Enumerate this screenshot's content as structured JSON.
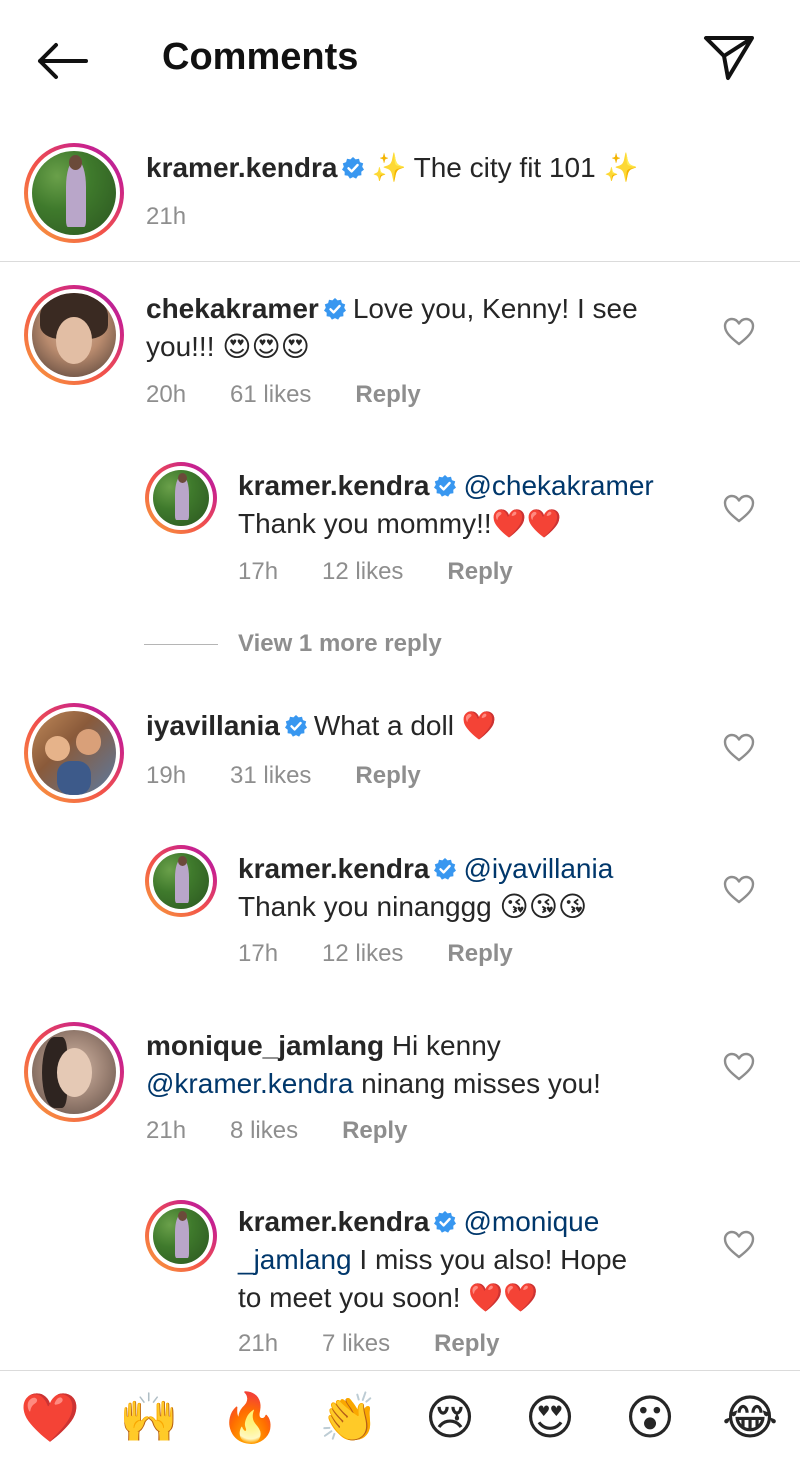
{
  "header": {
    "title": "Comments",
    "back_icon": "arrow-left-icon",
    "share_icon": "paper-plane-icon"
  },
  "caption": {
    "username": "kramer.kendra",
    "verified": true,
    "text": "✨ The city fit 101 ✨",
    "time": "21h"
  },
  "comments": [
    {
      "username": "chekakramer",
      "verified": true,
      "text_line1": "Love you, Kenny! I see",
      "text_line2": "you!!! 😍😍😍",
      "time": "20h",
      "likes": "61 likes",
      "reply_label": "Reply"
    },
    {
      "username": "kramer.kendra",
      "verified": true,
      "mention": "@chekakramer",
      "text": "Thank you mommy!!❤️❤️",
      "time": "17h",
      "likes": "12 likes",
      "reply_label": "Reply"
    },
    {
      "username": "iyavillania",
      "verified": true,
      "text": "What a doll ❤️",
      "time": "19h",
      "likes": "31 likes",
      "reply_label": "Reply"
    },
    {
      "username": "kramer.kendra",
      "verified": true,
      "mention": "@iyavillania",
      "text": "Thank you ninanggg 😘😘😘",
      "time": "17h",
      "likes": "12 likes",
      "reply_label": "Reply"
    },
    {
      "username": "monique_jamlang",
      "verified": false,
      "text_line1": "Hi kenny",
      "mention": "@kramer.kendra",
      "text_line2": "ninang misses you!",
      "time": "21h",
      "likes": "8 likes",
      "reply_label": "Reply"
    },
    {
      "username": "kramer.kendra",
      "verified": true,
      "mention_part1": "@monique",
      "mention_part2": "_jamlang",
      "text_line2": "I miss you also! Hope",
      "text_line3": "to meet you soon! ❤️❤️",
      "time": "21h",
      "likes": "7 likes",
      "reply_label": "Reply"
    }
  ],
  "view_more": "View 1 more reply",
  "emoji_bar": [
    "❤️",
    "🙌",
    "🔥",
    "👏",
    "😢",
    "😍",
    "😮",
    "😂"
  ],
  "colors": {
    "verified_blue": "#3897f0",
    "mention_blue": "#00376b",
    "meta_gray": "#8e8e8e"
  }
}
